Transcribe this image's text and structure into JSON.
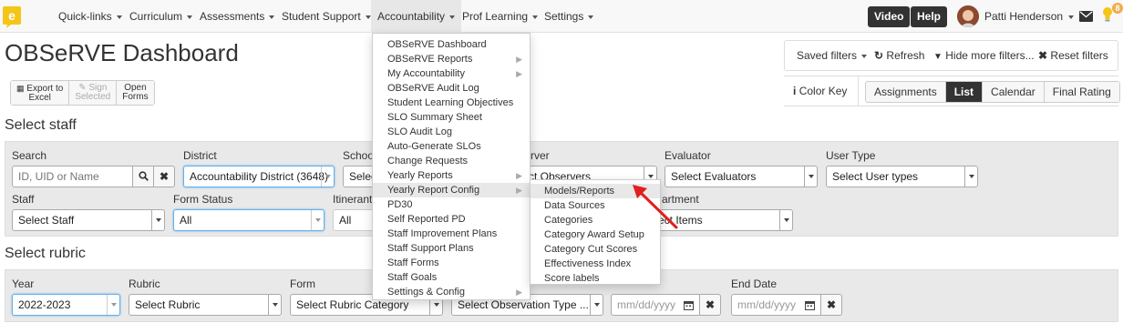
{
  "nav": {
    "items": [
      {
        "label": "Quick-links"
      },
      {
        "label": "Curriculum"
      },
      {
        "label": "Assessments"
      },
      {
        "label": "Student Support"
      },
      {
        "label": "Accountability"
      },
      {
        "label": "Prof Learning"
      },
      {
        "label": "Settings"
      }
    ],
    "video_label": "Video",
    "help_label": "Help",
    "user_name": "Patti Henderson",
    "notification_count": "8",
    "logo_icon": "logo-icon",
    "mail_icon": "envelope-icon",
    "bulb_icon": "lightbulb-icon"
  },
  "page": {
    "title": "OBSeRVE Dashboard"
  },
  "toolbar": {
    "export_line1": "Export to",
    "export_line2": "Excel",
    "sign_line1": "Sign",
    "sign_line2": "Selected",
    "open_line1": "Open",
    "open_line2": "Forms"
  },
  "filters": {
    "saved_filters": "Saved filters",
    "refresh": "Refresh",
    "hide_more": "Hide more filters...",
    "reset": "Reset filters"
  },
  "views": {
    "color_key": "Color Key",
    "tabs": [
      "Assignments",
      "List",
      "Calendar",
      "Final Rating"
    ],
    "active": "List"
  },
  "select_staff": {
    "heading": "Select staff",
    "search_label": "Search",
    "search_placeholder": "ID, UID or Name",
    "district_label": "District",
    "district_value": "Accountability District (3648)",
    "school_label": "Schoo",
    "school_value": "Selec",
    "observer_label": "rver",
    "observer_value": "ct Observers",
    "evaluator_label": "Evaluator",
    "evaluator_value": "Select Evaluators",
    "user_type_label": "User Type",
    "user_type_value": "Select User types",
    "staff_label": "Staff",
    "staff_value": "Select Staff",
    "form_status_label": "Form Status",
    "form_status_value": "All",
    "itinerant_label": "Itinerant",
    "itinerant_value": "All",
    "department_label": "artment",
    "department_value": "ect Items"
  },
  "select_rubric": {
    "heading": "Select rubric",
    "year_label": "Year",
    "year_value": "2022-2023",
    "rubric_label": "Rubric",
    "rubric_value": "Select Rubric",
    "form_label": "Form",
    "form_value": "Select Rubric Category",
    "obs_type_value": "Select Observation Type ...",
    "start_placeholder": "mm/dd/yyyy",
    "end_label": "End Date",
    "end_placeholder": "mm/dd/yyyy"
  },
  "accountability_menu": {
    "items": [
      {
        "label": "OBSeRVE Dashboard",
        "submenu": false
      },
      {
        "label": "OBSeRVE Reports",
        "submenu": true
      },
      {
        "label": "My Accountability",
        "submenu": true
      },
      {
        "label": "OBSeRVE Audit Log",
        "submenu": false
      },
      {
        "label": "Student Learning Objectives",
        "submenu": false
      },
      {
        "label": "SLO Summary Sheet",
        "submenu": false
      },
      {
        "label": "SLO Audit Log",
        "submenu": false
      },
      {
        "label": "Auto-Generate SLOs",
        "submenu": false
      },
      {
        "label": "Change Requests",
        "submenu": false
      },
      {
        "label": "Yearly Reports",
        "submenu": true
      },
      {
        "label": "Yearly Report Config",
        "submenu": true
      },
      {
        "label": "PD30",
        "submenu": false
      },
      {
        "label": "Self Reported PD",
        "submenu": false
      },
      {
        "label": "Staff Improvement Plans",
        "submenu": false
      },
      {
        "label": "Staff Support Plans",
        "submenu": false
      },
      {
        "label": "Staff Forms",
        "submenu": false
      },
      {
        "label": "Staff Goals",
        "submenu": false
      },
      {
        "label": "Settings & Config",
        "submenu": true
      }
    ],
    "active": "Yearly Report Config"
  },
  "yearly_report_config_submenu": {
    "items": [
      "Models/Reports",
      "Data Sources",
      "Categories",
      "Category Award Setup",
      "Category Cut Scores",
      "Effectiveness Index",
      "Score labels"
    ],
    "active": "Models/Reports"
  },
  "colors": {
    "nav_bg": "#f8f8f8",
    "dark_button": "#333333",
    "panel_bg": "#e9e9e9",
    "highlight": "#e8e8e8",
    "annotation_arrow": "#e02020",
    "badge": "#f0ad4e"
  }
}
